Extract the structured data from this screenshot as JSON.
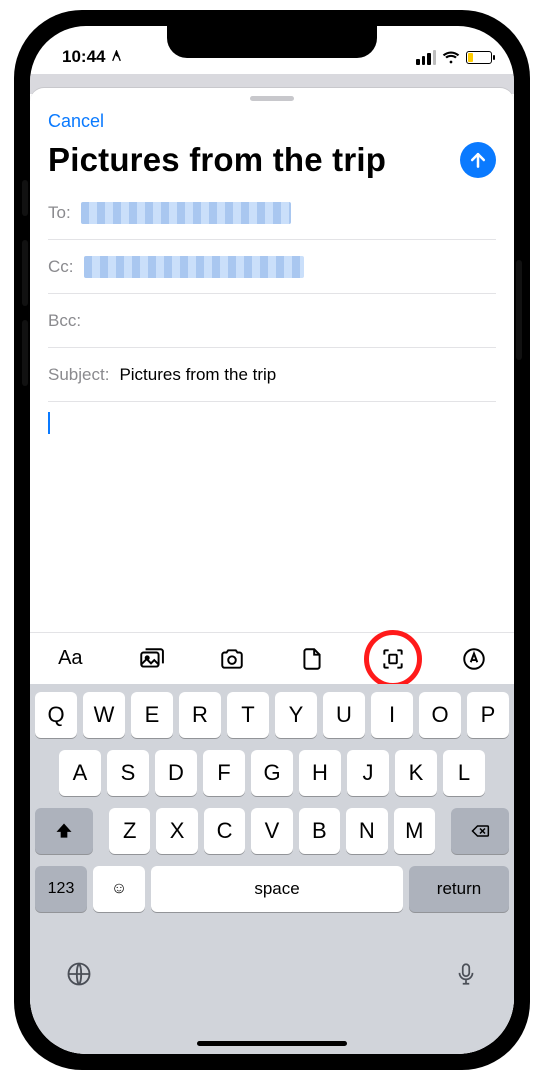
{
  "status": {
    "time": "10:44"
  },
  "compose": {
    "cancel": "Cancel",
    "title": "Pictures from the trip",
    "to_label": "To:",
    "cc_label": "Cc:",
    "bcc_label": "Bcc:",
    "subject_label": "Subject:",
    "subject_value": "Pictures from the trip"
  },
  "toolbar": {
    "format": "Aa"
  },
  "keyboard": {
    "row1": [
      "Q",
      "W",
      "E",
      "R",
      "T",
      "Y",
      "U",
      "I",
      "O",
      "P"
    ],
    "row2": [
      "A",
      "S",
      "D",
      "F",
      "G",
      "H",
      "J",
      "K",
      "L"
    ],
    "row3": [
      "Z",
      "X",
      "C",
      "V",
      "B",
      "N",
      "M"
    ],
    "numbers": "123",
    "space": "space",
    "return": "return"
  }
}
